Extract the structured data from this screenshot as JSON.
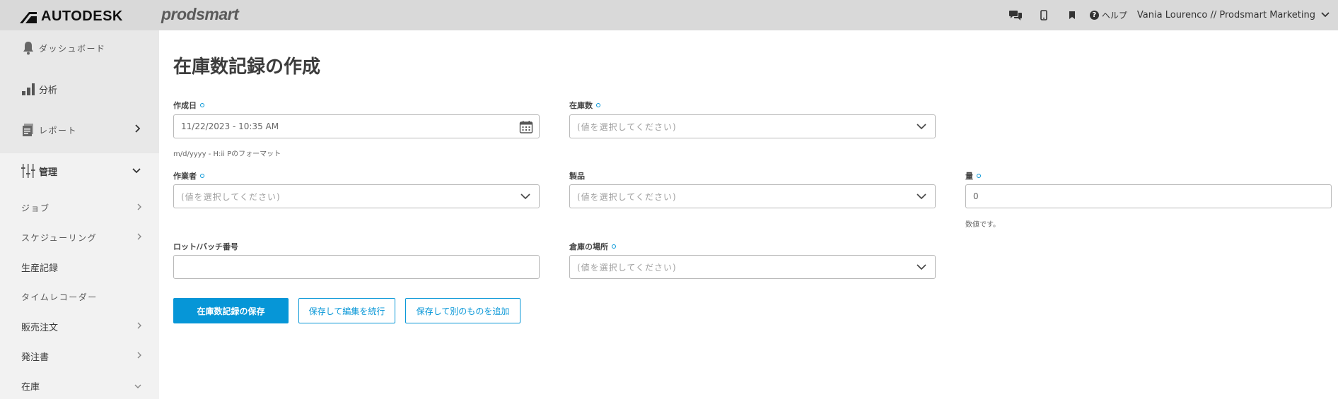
{
  "header": {
    "logo_text": "AUTODESK",
    "brand_text": "prodsmart",
    "help_label": "ヘルプ",
    "user_label": "Vania Lourenco // Prodsmart Marketing",
    "icons": [
      "chat-icon",
      "mobile-icon",
      "bookmark-icon",
      "help-icon",
      "chevron-down-icon"
    ]
  },
  "sidebar": {
    "items": [
      {
        "label": "ダッシュボード",
        "icon": "bell-icon"
      },
      {
        "label": "分析",
        "icon": "bar-chart-icon"
      },
      {
        "label": "レポート",
        "icon": "report-icon"
      },
      {
        "label": "管理",
        "icon": "sliders-icon"
      }
    ],
    "sub_items": [
      {
        "label": "ジョブ"
      },
      {
        "label": "スケジューリング"
      },
      {
        "label": "生産記録"
      },
      {
        "label": "タイムレコーダー"
      },
      {
        "label": "販売注文"
      },
      {
        "label": "発注書"
      },
      {
        "label": "在庫"
      }
    ]
  },
  "form": {
    "title": "在庫数記録の作成",
    "created_date": {
      "label": "作成日",
      "value": "11/22/2023 - 10:35 AM",
      "hint": "m/d/yyyy - H:ii Pのフォーマット"
    },
    "stock_count": {
      "label": "在庫数",
      "placeholder": "(値を選択してください)"
    },
    "operator": {
      "label": "作業者",
      "placeholder": "(値を選択してください)"
    },
    "product": {
      "label": "製品",
      "placeholder": "(値を選択してください)"
    },
    "quantity": {
      "label": "量",
      "value": "0",
      "hint": "数値です。"
    },
    "lot_batch": {
      "label": "ロット/バッチ番号",
      "value": ""
    },
    "warehouse_location": {
      "label": "倉庫の場所",
      "placeholder": "(値を選択してください)"
    },
    "buttons": {
      "save": "在庫数記録の保存",
      "save_continue": "保存して編集を続行",
      "save_add": "保存して別のものを追加"
    }
  },
  "colors": {
    "accent": "#0696d7",
    "topbar": "#d9d9d9",
    "sidebar": "#f2f2f2"
  }
}
